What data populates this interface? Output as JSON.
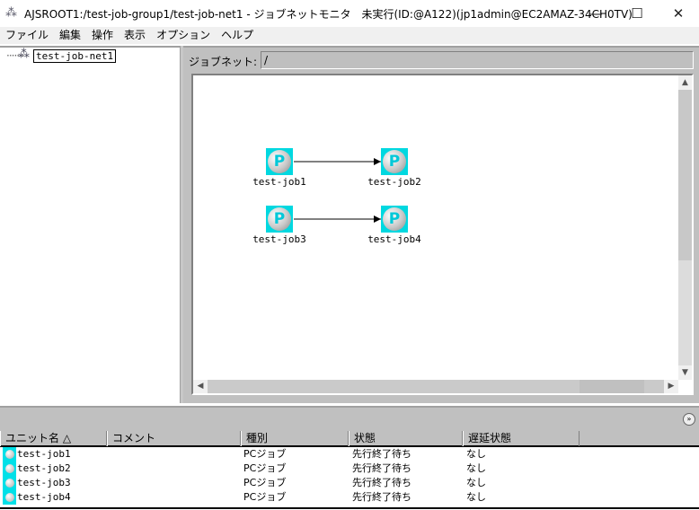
{
  "window": {
    "title": "AJSROOT1:/test-job-group1/test-job-net1 - ジョブネットモニタ　未実行(ID:@A122)(jp1admin@EC2AMAZ-34CH0TV)",
    "minimize": "—",
    "maximize": "☐",
    "close": "✕"
  },
  "menu": [
    "ファイル",
    "編集",
    "操作",
    "表示",
    "オプション",
    "ヘルプ"
  ],
  "tree": {
    "root": "test-job-net1"
  },
  "jobnet": {
    "label": "ジョブネット:",
    "path": "/"
  },
  "jobs": [
    {
      "name": "test-job1",
      "icon": "P"
    },
    {
      "name": "test-job2",
      "icon": "P"
    },
    {
      "name": "test-job3",
      "icon": "P"
    },
    {
      "name": "test-job4",
      "icon": "P"
    }
  ],
  "edges": [
    [
      "test-job1",
      "test-job2"
    ],
    [
      "test-job3",
      "test-job4"
    ]
  ],
  "list": {
    "columns": [
      "ユニット名 △",
      "コメント",
      "種別",
      "状態",
      "遅延状態"
    ],
    "rows": [
      {
        "name": "test-job1",
        "comment": "",
        "type": "PCジョブ",
        "status": "先行終了待ち",
        "delay": "なし"
      },
      {
        "name": "test-job2",
        "comment": "",
        "type": "PCジョブ",
        "status": "先行終了待ち",
        "delay": "なし"
      },
      {
        "name": "test-job3",
        "comment": "",
        "type": "PCジョブ",
        "status": "先行終了待ち",
        "delay": "なし"
      },
      {
        "name": "test-job4",
        "comment": "",
        "type": "PCジョブ",
        "status": "先行終了待ち",
        "delay": "なし"
      }
    ]
  },
  "colors": {
    "job_icon": "#00d8e0",
    "panel": "#c0c0c0"
  }
}
